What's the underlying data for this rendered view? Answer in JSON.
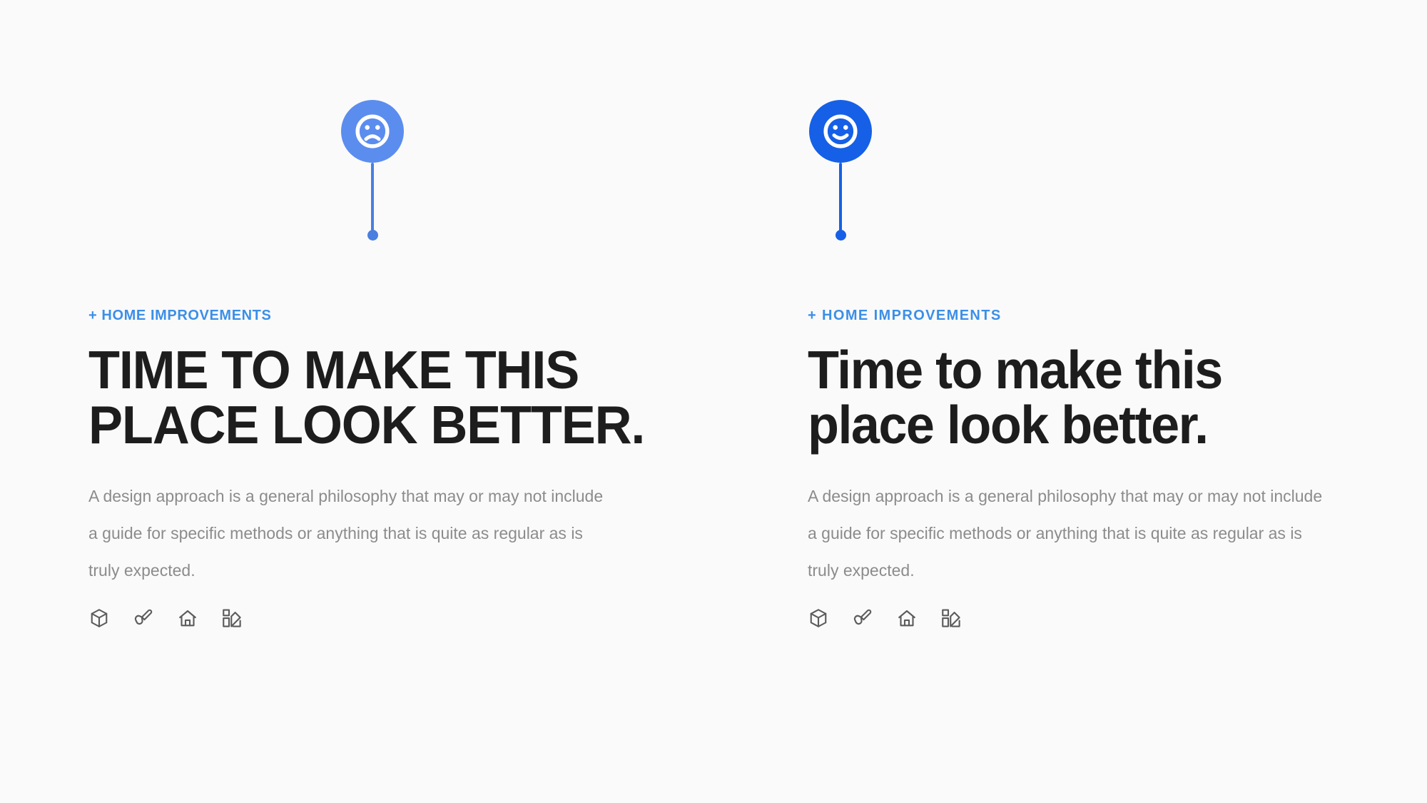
{
  "page": {
    "background_color": "#fafafa",
    "text_color": "#1d1d1d",
    "body_text_color": "#8c8c8c",
    "icon_color": "#5c5c5c",
    "eyebrow_color_left": "#3b8fe8",
    "eyebrow_color_right": "#3b8fe8"
  },
  "panels": [
    {
      "id": "left",
      "marker": {
        "icon": "frowning-face-icon",
        "badge_color": "#5b8def",
        "stem_color": "#4a7fe0",
        "dot_color": "#4a7fe0",
        "sentiment": "negative"
      },
      "eyebrow": "+ HOME IMPROVEMENTS",
      "headline": "TIME TO MAKE THIS PLACE LOOK BETTER.",
      "body": "A design approach is a general philosophy that may or may not include a guide for specific methods or anything that is quite as regular as is truly expected.",
      "icons": [
        {
          "name": "cube-icon",
          "label": "3D Model"
        },
        {
          "name": "paintbrush-icon",
          "label": "Painting"
        },
        {
          "name": "home-icon",
          "label": "Home"
        },
        {
          "name": "color-swatch-icon",
          "label": "Color Palette"
        }
      ]
    },
    {
      "id": "right",
      "marker": {
        "icon": "smiling-face-icon",
        "badge_color": "#1560e6",
        "stem_color": "#1560e6",
        "dot_color": "#1560e6",
        "sentiment": "positive"
      },
      "eyebrow": "+ HOME IMPROVEMENTS",
      "headline": "Time to make this place look better.",
      "body": "A design approach is a general philosophy that may or may not include a guide for specific methods or anything that is quite as regular as is truly expected.",
      "icons": [
        {
          "name": "cube-icon",
          "label": "3D Model"
        },
        {
          "name": "paintbrush-icon",
          "label": "Painting"
        },
        {
          "name": "home-icon",
          "label": "Home"
        },
        {
          "name": "color-swatch-icon",
          "label": "Color Palette"
        }
      ]
    }
  ]
}
